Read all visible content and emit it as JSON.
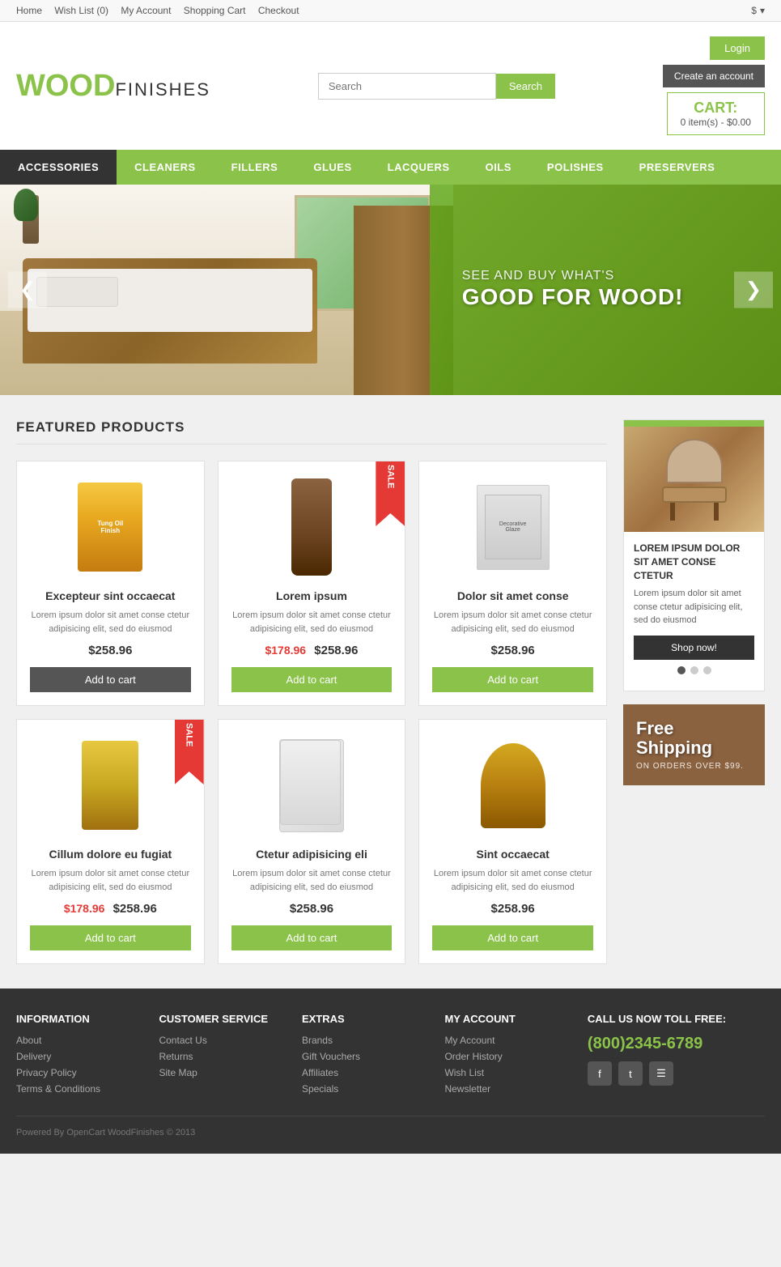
{
  "topbar": {
    "links": [
      "Home",
      "Wish List (0)",
      "My Account",
      "Shopping Cart",
      "Checkout"
    ],
    "currency": "$"
  },
  "header": {
    "logo_wood": "WOOD",
    "logo_finishes": "FINISHES",
    "search_placeholder": "Search",
    "search_button": "Search",
    "login_button": "Login",
    "create_account": "Create an account",
    "cart_title": "CART:",
    "cart_info": "0 item(s) - $0.00"
  },
  "nav": {
    "items": [
      "ACCESSORIES",
      "CLEANERS",
      "FILLERS",
      "GLUES",
      "LACQUERS",
      "OILS",
      "POLISHES",
      "PRESERVERS"
    ],
    "active": 0
  },
  "banner": {
    "text1": "SEE AND BUY WHAT'S",
    "text2": "GOOD FOR WOOD!"
  },
  "featured": {
    "heading": "FEATURED PRODUCTS",
    "products": [
      {
        "name": "Excepteur sint occaecat",
        "desc": "Lorem ipsum dolor sit amet conse ctetur adipisicing elit, sed do eiusmod",
        "price": "$258.96",
        "old_price": null,
        "sale": false,
        "btn": "Add to cart",
        "btn_dark": true
      },
      {
        "name": "Lorem ipsum",
        "desc": "Lorem ipsum dolor sit amet conse ctetur adipisicing elit, sed do eiusmod",
        "price": "$258.96",
        "old_price": "$178.96",
        "sale": true,
        "btn": "Add to cart",
        "btn_dark": false
      },
      {
        "name": "Dolor sit amet conse",
        "desc": "Lorem ipsum dolor sit amet conse ctetur adipisicing elit, sed do eiusmod",
        "price": "$258.96",
        "old_price": null,
        "sale": false,
        "btn": "Add to cart",
        "btn_dark": false
      },
      {
        "name": "Cillum dolore eu fugiat",
        "desc": "Lorem ipsum dolor sit amet conse ctetur adipisicing elit, sed do eiusmod",
        "price": "$258.96",
        "old_price": "$178.96",
        "sale": true,
        "btn": "Add to cart",
        "btn_dark": false
      },
      {
        "name": "Ctetur adipisicing eli",
        "desc": "Lorem ipsum dolor sit amet conse ctetur adipisicing elit, sed do eiusmod",
        "price": "$258.96",
        "old_price": null,
        "sale": false,
        "btn": "Add to cart",
        "btn_dark": false
      },
      {
        "name": "Sint occaecat",
        "desc": "Lorem ipsum dolor sit amet conse ctetur adipisicing elit, sed do eiusmod",
        "price": "$258.96",
        "old_price": null,
        "sale": false,
        "btn": "Add to cart",
        "btn_dark": false
      }
    ]
  },
  "sidebar": {
    "promo_title": "LOREM IPSUM DOLOR SIT AMET CONSE CTETUR",
    "promo_desc": "Lorem ipsum dolor sit amet conse ctetur adipisicing elit, sed do eiusmod",
    "shop_now": "Shop now!",
    "shipping_text": "Free\nShipping",
    "shipping_sub": "ON ORDERS OVER $99."
  },
  "footer": {
    "information": {
      "heading": "INFORMATION",
      "links": [
        "About",
        "Delivery",
        "Privacy Policy",
        "Terms & Conditions"
      ]
    },
    "customer_service": {
      "heading": "CUSTOMER SERVICE",
      "links": [
        "Contact Us",
        "Returns",
        "Site Map"
      ]
    },
    "extras": {
      "heading": "EXTRAS",
      "links": [
        "Brands",
        "Gift Vouchers",
        "Affiliates",
        "Specials"
      ]
    },
    "my_account": {
      "heading": "MY ACCOUNT",
      "links": [
        "My Account",
        "Order History",
        "Wish List",
        "Newsletter"
      ]
    },
    "contact": {
      "heading": "CALL US NOW TOLL FREE:",
      "phone": "(800)2345-6789"
    },
    "bottom": "Powered By OpenCart WoodFinishes © 2013"
  }
}
